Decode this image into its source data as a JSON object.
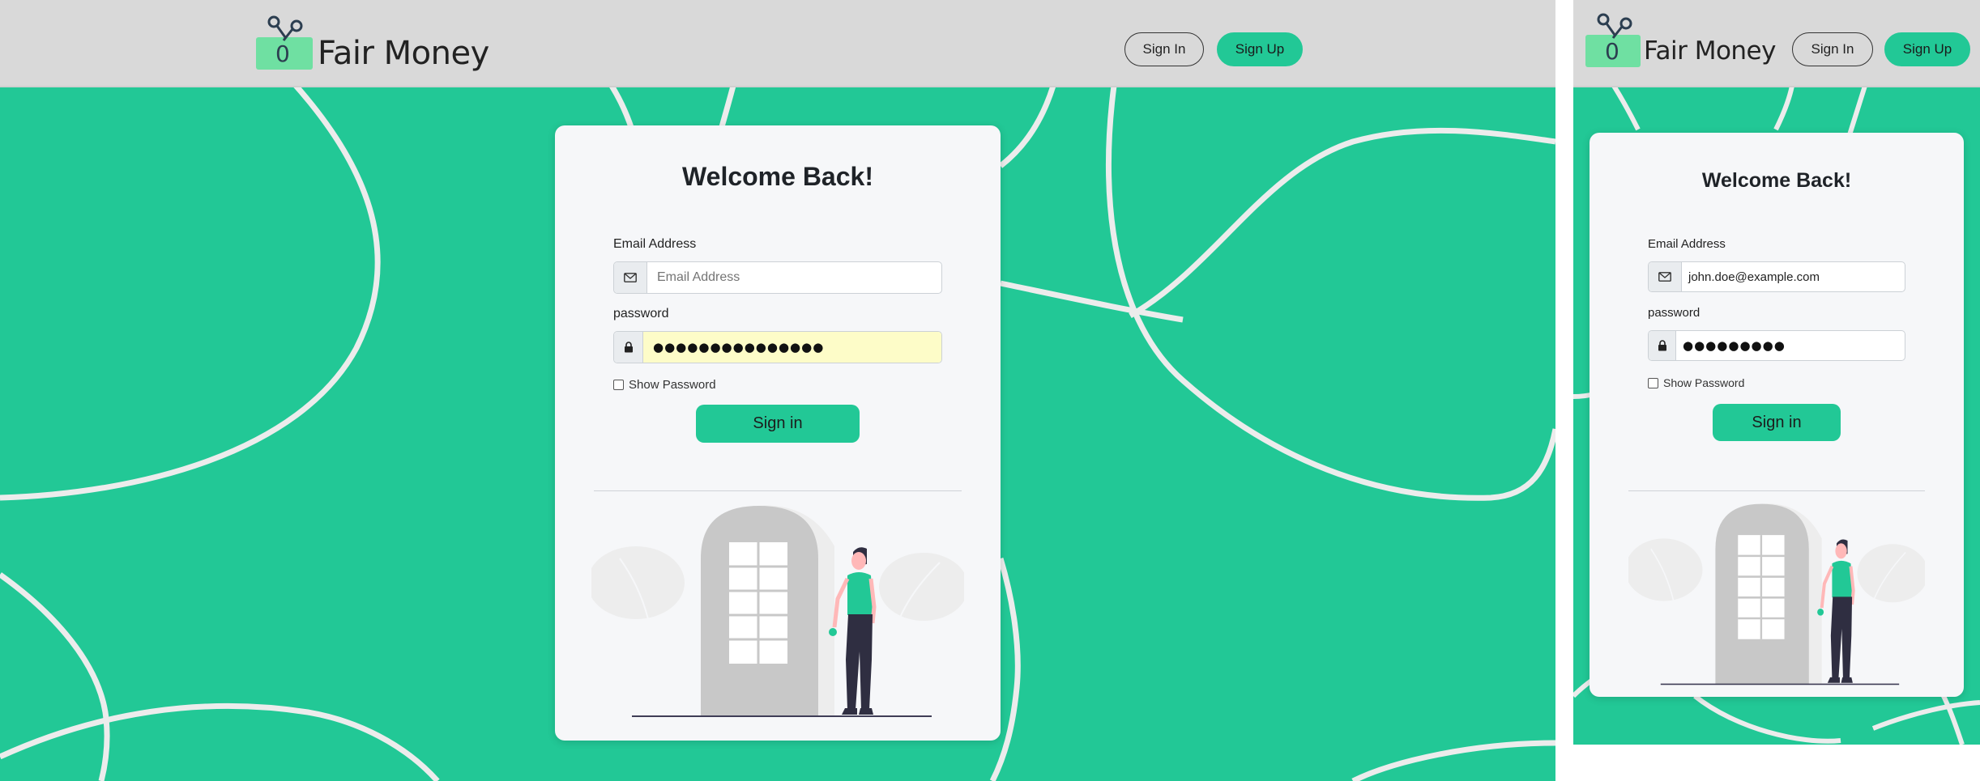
{
  "brand": {
    "name": "Fair Money",
    "logo_digit": "0",
    "logo_icon": "scissors-percent-icon"
  },
  "nav": {
    "sign_in_label": "Sign In",
    "sign_up_label": "Sign Up"
  },
  "colors": {
    "accent": "#22c896",
    "navbar": "#d9d9d9",
    "card": "#f6f7f9",
    "curve": "#ececec",
    "logo": "#6fe0a2"
  },
  "login_desktop": {
    "title": "Welcome Back!",
    "email": {
      "label": "Email Address",
      "value": "",
      "placeholder": "Email Address",
      "icon": "envelope-icon"
    },
    "password": {
      "label": "password",
      "value": "●●●●●●●●●●●●●●●",
      "icon": "lock-icon"
    },
    "show_password_label": "Show Password",
    "submit_label": "Sign in"
  },
  "login_mobile": {
    "title": "Welcome Back!",
    "email": {
      "label": "Email Address",
      "value": "john.doe@example.com",
      "icon": "envelope-icon"
    },
    "password": {
      "label": "password",
      "value": "●●●●●●●●●",
      "icon": "lock-icon"
    },
    "show_password_label": "Show Password",
    "submit_label": "Sign in"
  }
}
